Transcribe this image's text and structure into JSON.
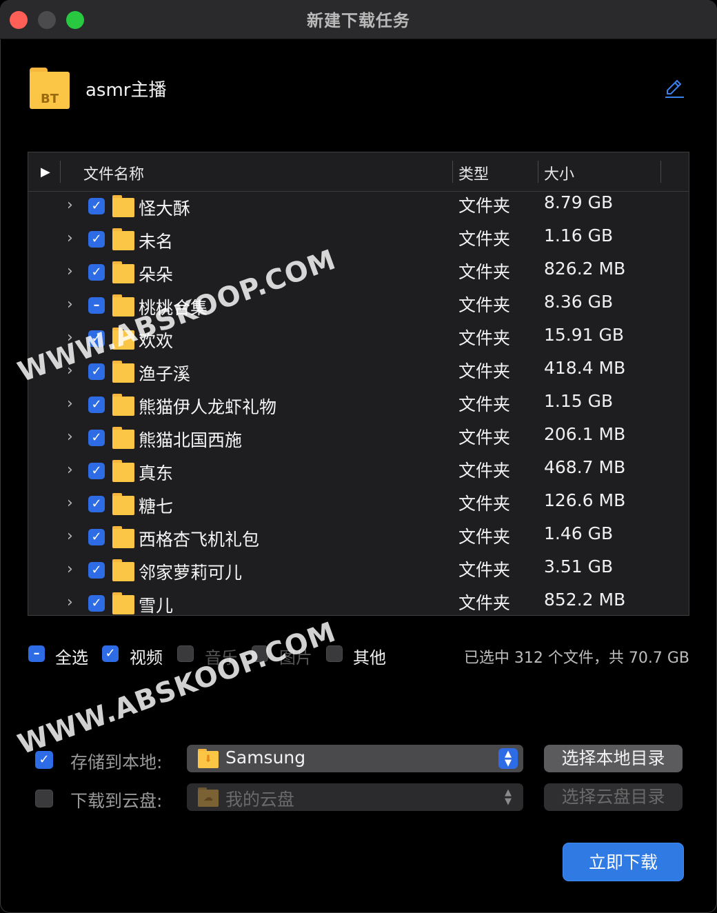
{
  "window": {
    "title": "新建下载任务"
  },
  "task": {
    "icon_label": "BT",
    "name": "asmr主播"
  },
  "table": {
    "headers": {
      "name": "文件名称",
      "type": "类型",
      "size": "大小"
    },
    "rows": [
      {
        "name": "怪大酥",
        "type": "文件夹",
        "size": "8.79 GB",
        "checked": "full"
      },
      {
        "name": "未名",
        "type": "文件夹",
        "size": "1.16 GB",
        "checked": "full"
      },
      {
        "name": "朵朵",
        "type": "文件夹",
        "size": "826.2 MB",
        "checked": "full"
      },
      {
        "name": "桃桃合集",
        "type": "文件夹",
        "size": "8.36 GB",
        "checked": "partial"
      },
      {
        "name": "欢欢",
        "type": "文件夹",
        "size": "15.91 GB",
        "checked": "full"
      },
      {
        "name": "渔子溪",
        "type": "文件夹",
        "size": "418.4 MB",
        "checked": "full"
      },
      {
        "name": "熊猫伊人龙虾礼物",
        "type": "文件夹",
        "size": "1.15 GB",
        "checked": "full"
      },
      {
        "name": "熊猫北国西施",
        "type": "文件夹",
        "size": "206.1 MB",
        "checked": "full"
      },
      {
        "name": "真东",
        "type": "文件夹",
        "size": "468.7 MB",
        "checked": "full"
      },
      {
        "name": "糖七",
        "type": "文件夹",
        "size": "126.6 MB",
        "checked": "full"
      },
      {
        "name": "西格杏飞机礼包",
        "type": "文件夹",
        "size": "1.46 GB",
        "checked": "full"
      },
      {
        "name": "邻家萝莉可儿",
        "type": "文件夹",
        "size": "3.51 GB",
        "checked": "full"
      },
      {
        "name": "雪儿",
        "type": "文件夹",
        "size": "852.2 MB",
        "checked": "full"
      }
    ]
  },
  "filters": {
    "select_all": "全选",
    "video": "视频",
    "music": "音乐",
    "image": "图片",
    "other": "其他",
    "summary": "已选中 312 个文件，共 70.7 GB"
  },
  "destination": {
    "local_label": "存储到本地:",
    "local_value": "Samsung",
    "local_button": "选择本地目录",
    "cloud_label": "下载到云盘:",
    "cloud_value": "我的云盘",
    "cloud_button": "选择云盘目录"
  },
  "actions": {
    "download": "立即下载"
  },
  "watermark": "WWW.ABSKOOP.COM",
  "colors": {
    "accent": "#2e6ce6",
    "folder": "#fbc545",
    "background": "#000000",
    "close": "#ff5f57",
    "maximize": "#28c840"
  }
}
